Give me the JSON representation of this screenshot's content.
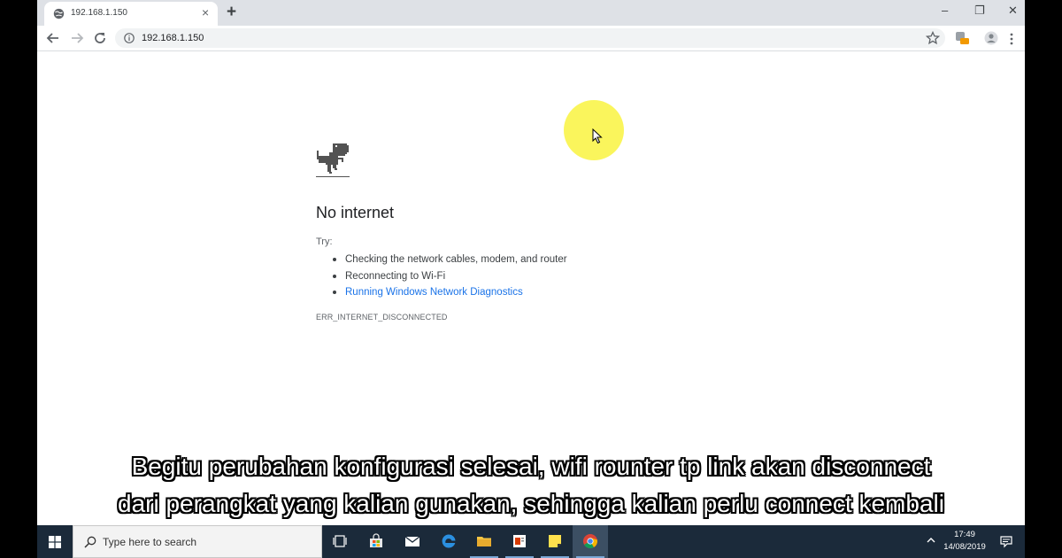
{
  "browser": {
    "tab_title": "192.168.1.150",
    "url": "192.168.1.150",
    "new_tab_symbol": "+",
    "tab_close_symbol": "×",
    "window_controls": {
      "minimize": "–",
      "restore": "❐",
      "close": "✕"
    }
  },
  "page": {
    "title": "No internet",
    "try_label": "Try:",
    "suggestions": [
      "Checking the network cables, modem, and router",
      "Reconnecting to Wi-Fi",
      "Running Windows Network Diagnostics"
    ],
    "error_code": "ERR_INTERNET_DISCONNECTED"
  },
  "subtitles": {
    "line1": "Begitu perubahan konfigurasi selesai, wifi rounter tp link akan disconnect",
    "line2": "dari perangkat yang kalian gunakan, sehingga kalian perlu connect kembali"
  },
  "taskbar": {
    "search_placeholder": "Type here to search",
    "time": "17:49",
    "date": "14/08/2019",
    "apps": [
      "task-view",
      "store",
      "mail",
      "edge",
      "file-explorer",
      "office",
      "sticky-notes",
      "chrome"
    ]
  },
  "colors": {
    "link": "#1a73e8",
    "cursor_highlight": "#f9f44a",
    "taskbar": "#1b2a3a"
  }
}
